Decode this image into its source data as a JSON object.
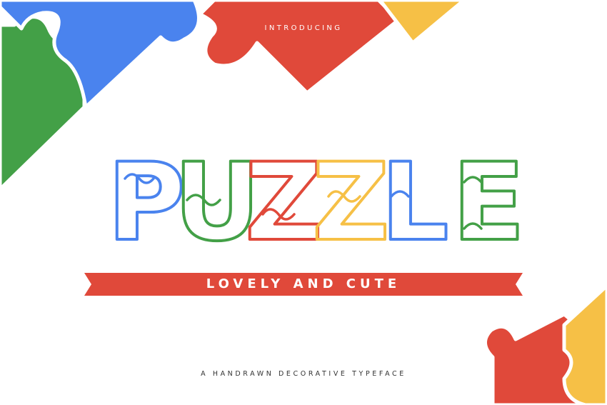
{
  "intro": "INTRODUCING",
  "title": "PUZZLE",
  "ribbon_text": "LOVELY AND CUTE",
  "tagline": "A HANDRAWN DECORATIVE TYPEFACE",
  "colors": {
    "red": "#e0493a",
    "blue": "#4a83ee",
    "green": "#43a047",
    "yellow": "#f6c046",
    "dark_text": "#333333",
    "background": "#ffffff"
  }
}
